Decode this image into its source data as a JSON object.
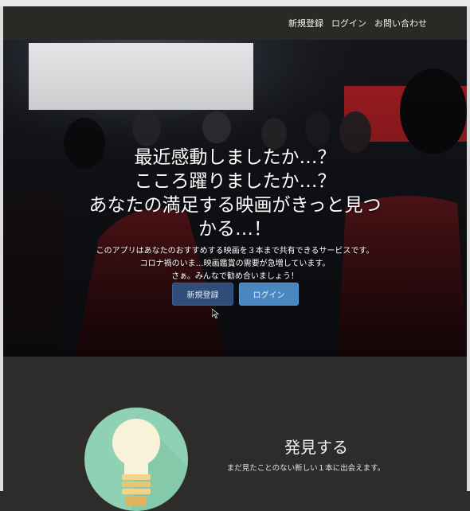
{
  "nav": {
    "links": [
      "新規登録",
      "ログイン",
      "お問い合わせ"
    ]
  },
  "hero": {
    "title_lines": [
      "最近感動しましたか…？",
      "こころ躍りましたか…？",
      "あなたの満足する映画がきっと見つ",
      "かる…！"
    ],
    "description_lines": [
      "このアプリはあなたのおすすめする映画を３本まで共有できるサービスです。",
      "コロナ禍のいま…映画鑑賞の需要が急増しています。",
      "さぁ。みんなで勧め合いましょう！"
    ],
    "signup_button": "新規登録",
    "login_button": "ログイン"
  },
  "feature": {
    "icon": "lightbulb-icon",
    "title": "発見する",
    "description": "まだ見たことのない新しい１本に出会えます。"
  },
  "colors": {
    "page_bg": "#2e2c2a",
    "signup_button": "#2f4d78",
    "login_button": "#4a86c0",
    "feature_circle": "#8fd1b4"
  }
}
